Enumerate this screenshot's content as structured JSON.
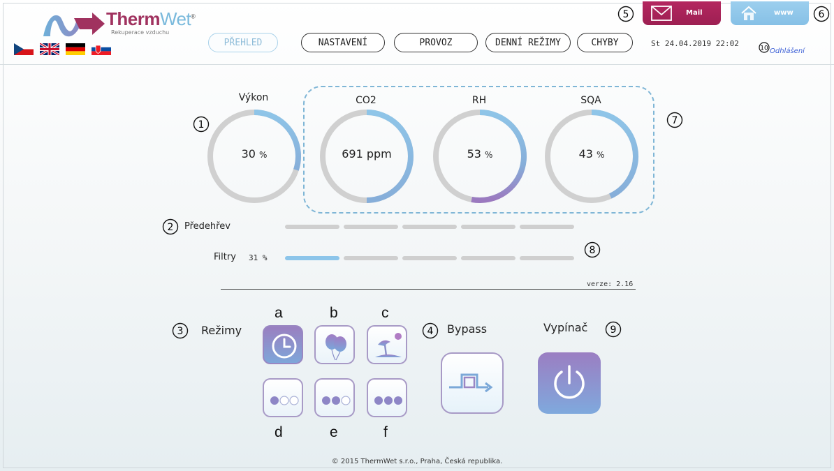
{
  "header": {
    "brand_part1": "Therm",
    "brand_part2": "Wet",
    "brand_reg": "®",
    "brand_subtitle": "Rekuperace vzduchu",
    "flags": [
      "cz-flag",
      "uk-flag",
      "de-flag",
      "sk-flag"
    ],
    "nav": [
      {
        "label": "PŘEHLED",
        "active": true
      },
      {
        "label": "NASTAVENÍ",
        "active": false
      },
      {
        "label": "PROVOZ",
        "active": false
      },
      {
        "label": "DENNÍ REŽIMY",
        "active": false
      },
      {
        "label": "CHYBY",
        "active": false
      }
    ],
    "datetime": "St 24.04.2019  22:02",
    "logout": "Odhlášení",
    "mail_label": "Mail",
    "www_label": "www"
  },
  "gauges": [
    {
      "title": "Výkon",
      "value": "30",
      "unit": "%",
      "level": 0.3
    },
    {
      "title": "CO2",
      "value": "691",
      "unit": "ppm",
      "level": 0.5
    },
    {
      "title": "RH",
      "value": "53",
      "unit": "%",
      "level": 0.53
    },
    {
      "title": "SQA",
      "value": "43",
      "unit": "%",
      "level": 0.43
    }
  ],
  "preheat": {
    "label": "Předehřev",
    "segments_on": 0,
    "segments_total": 5
  },
  "filters": {
    "label": "Filtry",
    "value": "31 %",
    "segments_on": 1,
    "segments_total": 5
  },
  "version": "verze: 2.16",
  "modes": {
    "label": "Režimy",
    "letters": [
      "a",
      "b",
      "c",
      "d",
      "e",
      "f"
    ],
    "icons": [
      "clock-icon",
      "balloons-icon",
      "island-icon",
      "fan-level-1-icon",
      "fan-level-2-icon",
      "fan-level-3-icon"
    ],
    "active_index": 0
  },
  "bypass": {
    "label": "Bypass"
  },
  "power": {
    "label": "Vypínač"
  },
  "callouts": {
    "n1": "1",
    "n2": "2",
    "n3": "3",
    "n4": "4",
    "n5": "5",
    "n6": "6",
    "n7": "7",
    "n8": "8",
    "n9": "9",
    "n10": "10"
  },
  "footer": "© 2015 ThermWet s.r.o., Praha, Česká republika.",
  "colors": {
    "brand": "#a0325f",
    "accent_blue": "#8cc5ea",
    "purple": "#9a7fc0",
    "mail": "#a8235a",
    "www": "#8fc5e8"
  }
}
